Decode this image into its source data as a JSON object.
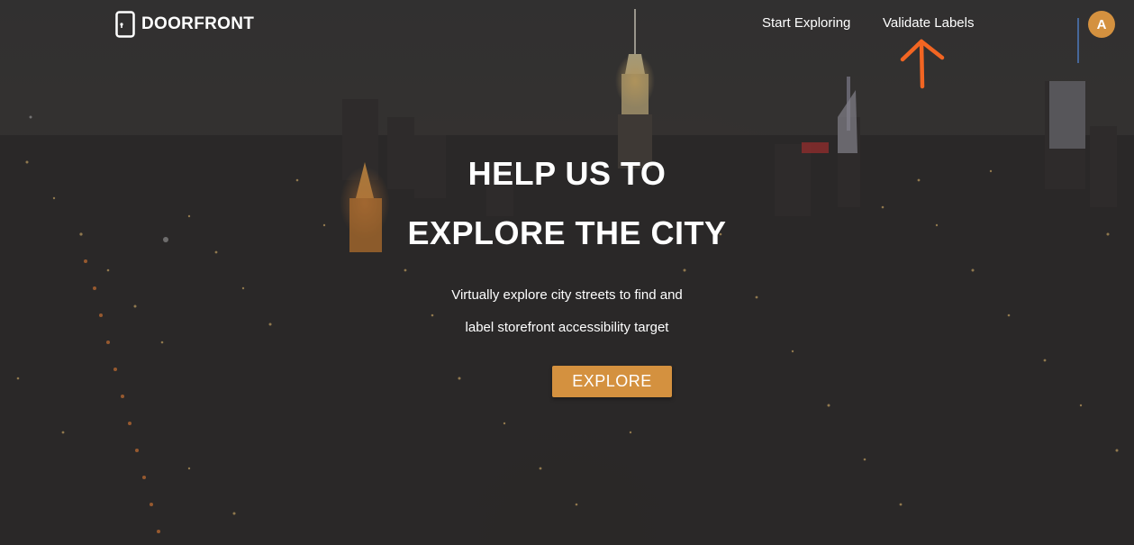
{
  "nav": {
    "logo_text": "DOORFRONT",
    "logo_icon": "door-icon",
    "links": [
      {
        "label": "Start Exploring"
      },
      {
        "label": "Validate Labels"
      }
    ],
    "avatar_initial": "A"
  },
  "hero": {
    "headline_line1": "HELP US TO",
    "headline_line2": "EXPLORE THE CITY",
    "subtitle_line1": "Virtually explore city streets to find and",
    "subtitle_line2": "label storefront accessibility target",
    "cta_label": "EXPLORE",
    "background": "night-city-skyline"
  },
  "annotation": {
    "icon": "arrow-up-icon",
    "color": "#f26522"
  },
  "colors": {
    "accent": "#d4913f",
    "text": "#ffffff",
    "annotation": "#f26522"
  }
}
